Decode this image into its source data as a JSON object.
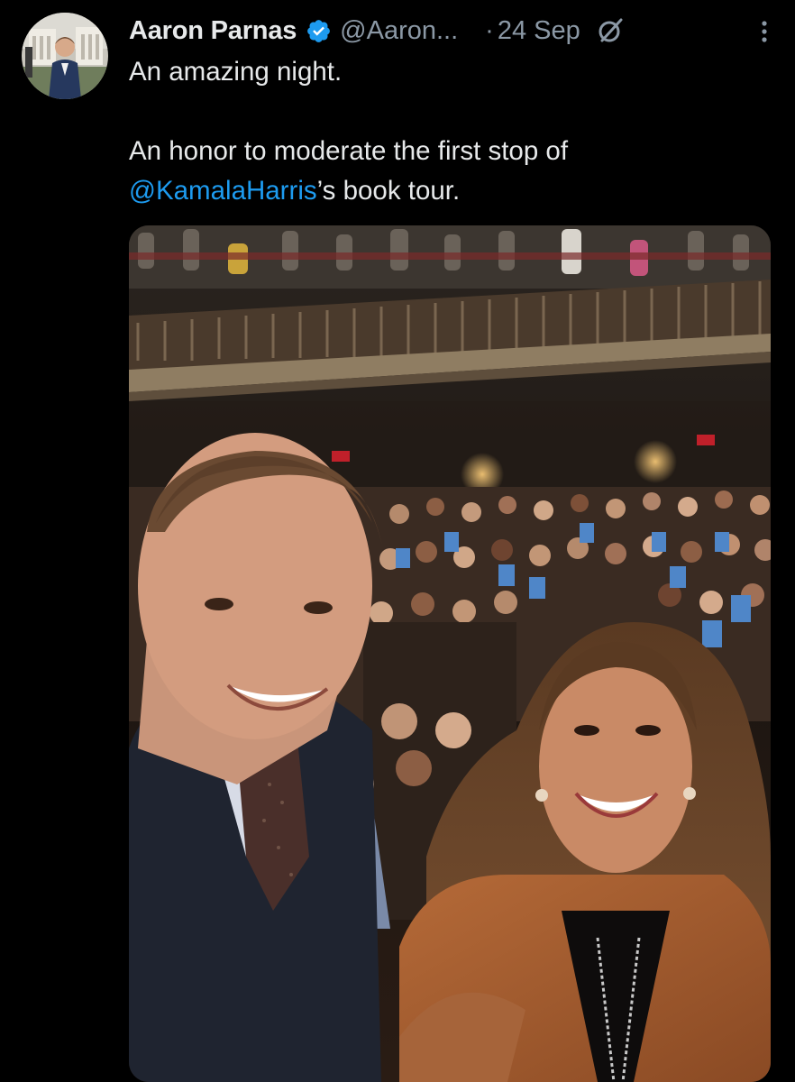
{
  "tweet": {
    "author_name": "Aaron Parnas",
    "handle": "@Aaron...",
    "separator": "·",
    "timestamp": "24 Sep",
    "verified": true,
    "text_line1": "An amazing night.",
    "text_line2": "An honor to moderate the first stop of",
    "mention": "@KamalaHarris",
    "text_line3_rest": "’s book tour.",
    "icons": {
      "verified": "verified-badge-icon",
      "grok": "grok-icon",
      "more": "more-options-icon"
    },
    "colors": {
      "background": "#000000",
      "text": "#e7e9ea",
      "secondary": "#8b98a5",
      "accent": "#1d9bf0"
    }
  }
}
